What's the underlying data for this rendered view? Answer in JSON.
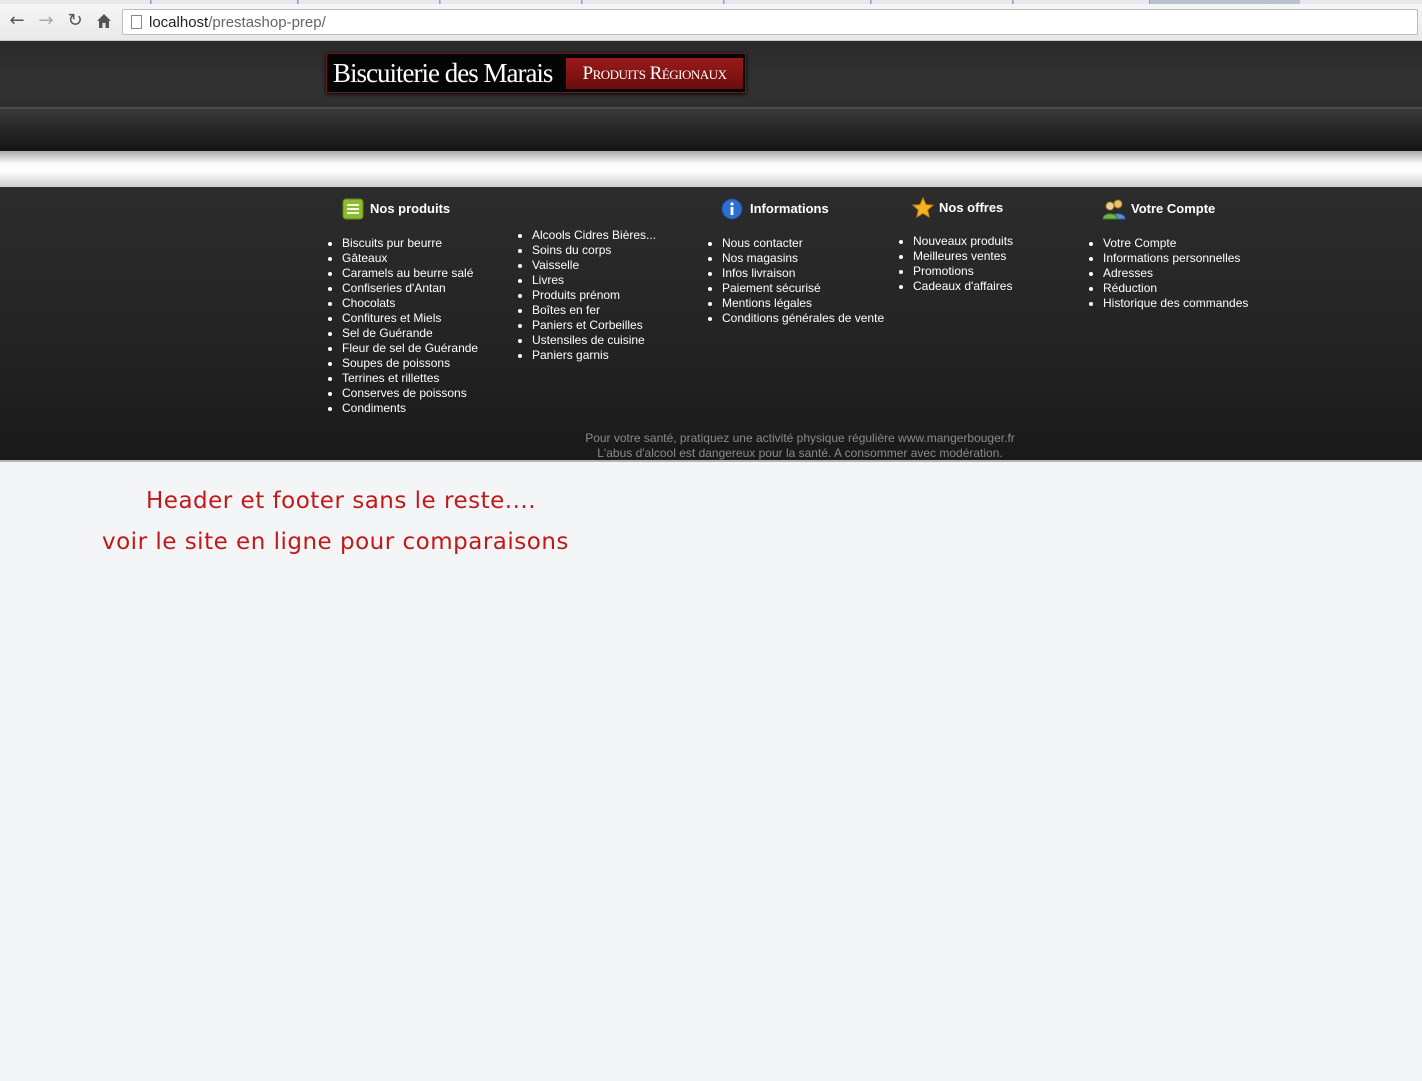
{
  "browser": {
    "back_icon": "arrow-left-icon",
    "forward_icon": "arrow-right-icon",
    "reload_icon": "reload-icon",
    "home_icon": "home-icon",
    "url_host": "localhost",
    "url_path": "/prestashop-prep/"
  },
  "header": {
    "logo_name": "Biscuiterie des Marais",
    "logo_tag": "Produits Régionaux"
  },
  "footer": {
    "products": {
      "title": "Nos produits",
      "icon": "list-icon",
      "items_col1": [
        "Biscuits pur beurre",
        "Gâteaux",
        "Caramels au beurre salé",
        "Confiseries d'Antan",
        "Chocolats",
        "Confitures et Miels",
        "Sel de Guérande",
        "Fleur de sel de Guérande",
        "Soupes de poissons",
        "Terrines et rillettes",
        "Conserves de poissons",
        "Condiments"
      ],
      "items_col2": [
        "Alcools Cidres Bières...",
        "Soins du corps",
        "Vaisselle",
        "Livres",
        "Produits prénom",
        "Boîtes en fer",
        "Paniers et Corbeilles",
        "Ustensiles de cuisine",
        "Paniers garnis"
      ]
    },
    "informations": {
      "title": "Informations",
      "icon": "info-icon",
      "items": [
        "Nous contacter",
        "Nos magasins",
        "Infos livraison",
        "Paiement sécurisé",
        "Mentions légales",
        "Conditions générales de vente"
      ]
    },
    "offers": {
      "title": "Nos offres",
      "icon": "star-icon",
      "items": [
        "Nouveaux produits",
        "Meilleures ventes",
        "Promotions",
        "Cadeaux d'affaires"
      ]
    },
    "account": {
      "title": "Votre Compte",
      "icon": "users-icon",
      "items": [
        "Votre Compte",
        "Informations personnelles",
        "Adresses",
        "Réduction",
        "Historique des commandes"
      ]
    },
    "note_line1": "Pour votre santé, pratiquez une activité physique régulière www.mangerbouger.fr",
    "note_line2": "L'abus d'alcool est dangereux pour la santé. A consommer avec modération."
  },
  "annotation": {
    "line1": "Header et footer sans le reste....",
    "line2": "voir le site en ligne pour comparaisons"
  },
  "colors": {
    "annotation": "#c31818",
    "footer_bg": "#232323",
    "logo_tag_bg": "#9b1b1b"
  }
}
